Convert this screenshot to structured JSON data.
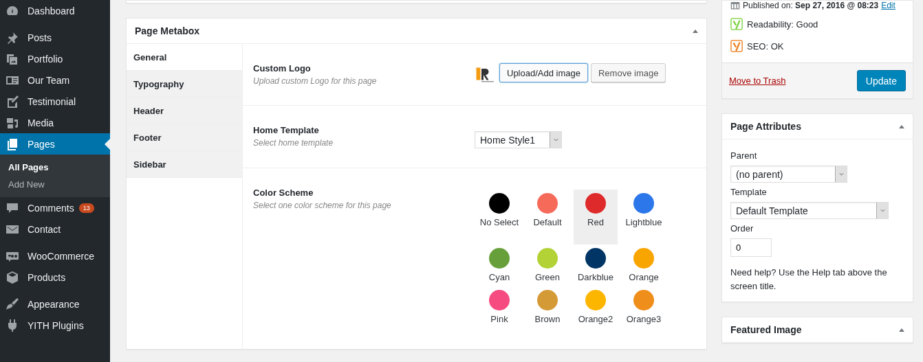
{
  "admin_menu": {
    "groups": [
      [
        {
          "label": "Dashboard",
          "selected": false
        }
      ],
      [
        {
          "label": "Posts",
          "selected": false
        },
        {
          "label": "Portfolio",
          "selected": false
        },
        {
          "label": "Our Team",
          "selected": false
        },
        {
          "label": "Testimonial",
          "selected": false
        },
        {
          "label": "Media",
          "selected": false
        },
        {
          "label": "Pages",
          "selected": true,
          "children": [
            {
              "label": "All Pages",
              "selected": true
            },
            {
              "label": "Add New",
              "selected": false
            }
          ]
        },
        {
          "label": "Comments",
          "selected": false,
          "badge": "13"
        },
        {
          "label": "Contact",
          "selected": false
        }
      ],
      [
        {
          "label": "WooCommerce",
          "selected": false
        },
        {
          "label": "Products",
          "selected": false
        }
      ],
      [
        {
          "label": "Appearance",
          "selected": false
        },
        {
          "label": "YITH Plugins",
          "selected": false
        }
      ]
    ]
  },
  "metabox": {
    "title": "Page Metabox",
    "tabs": [
      {
        "label": "General",
        "selected": true
      },
      {
        "label": "Typography",
        "selected": false
      },
      {
        "label": "Header",
        "selected": false
      },
      {
        "label": "Footer",
        "selected": false
      },
      {
        "label": "Sidebar",
        "selected": false
      }
    ],
    "fields": [
      {
        "kind": "image",
        "label": "Custom Logo",
        "description": "Upload custom Logo for this page",
        "buttons": [
          "Upload/Add image",
          "Remove image"
        ]
      },
      {
        "kind": "select",
        "label": "Home Template",
        "description": "Select home template",
        "value": "Home Style1"
      },
      {
        "kind": "colors",
        "label": "Color Scheme",
        "description": "Select one color scheme for this page",
        "options": [
          {
            "label": "No Select",
            "color": "#000000",
            "selected": false
          },
          {
            "label": "Default",
            "color": "#f66a5a",
            "selected": false
          },
          {
            "label": "Red",
            "color": "#de2a2a",
            "selected": true
          },
          {
            "label": "Lightblue",
            "color": "#2c77ea",
            "selected": false
          },
          {
            "label": "Cyan",
            "color": "#67a03a",
            "selected": false
          },
          {
            "label": "Green",
            "color": "#b2d235",
            "selected": false
          },
          {
            "label": "Darkblue",
            "color": "#003565",
            "selected": false
          },
          {
            "label": "Orange",
            "color": "#f9a500",
            "selected": false
          },
          {
            "label": "Pink",
            "color": "#f64b80",
            "selected": false
          },
          {
            "label": "Brown",
            "color": "#d49a36",
            "selected": false
          },
          {
            "label": "Orange2",
            "color": "#fdb600",
            "selected": false
          },
          {
            "label": "Orange3",
            "color": "#ef8e1a",
            "selected": false
          }
        ]
      }
    ]
  },
  "publish": {
    "published_on": "Published on: ",
    "date": "Sep 27, 2016 @ 08:23",
    "edit_link": "Edit",
    "readability": "Readability: Good",
    "seo": "SEO: OK",
    "trash_link": "Move to Trash",
    "update_button": "Update"
  },
  "page_attributes": {
    "title": "Page Attributes",
    "parent_label": "Parent",
    "parent_value": "(no parent)",
    "template_label": "Template",
    "template_value": "Default Template",
    "order_label": "Order",
    "order_value": "0",
    "help": "Need help? Use the Help tab above the screen title."
  },
  "featured_image": {
    "title": "Featured Image"
  }
}
